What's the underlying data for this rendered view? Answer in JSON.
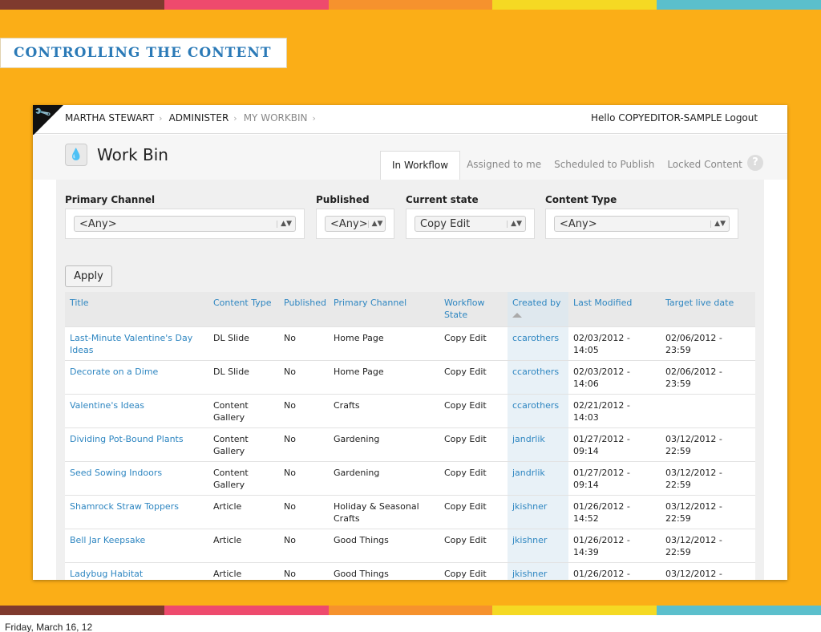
{
  "slide": {
    "title": "CONTROLLING THE CONTENT",
    "date": "Friday, March 16, 12",
    "stripe_colors": [
      "#7f3a2e",
      "#ee4a6d",
      "#f6922d",
      "#f5d923",
      "#5bbfcc"
    ],
    "background_color": "#fbae17"
  },
  "topbar": {
    "breadcrumbs": [
      "MARTHA STEWART",
      "ADMINISTER",
      "MY WORKBIN"
    ],
    "greeting": "Hello COPYEDITOR-SAMPLE",
    "logout": "Logout"
  },
  "page": {
    "title": "Work Bin",
    "tabs": [
      "In Workflow",
      "Assigned to me",
      "Scheduled to Publish",
      "Locked Content"
    ],
    "active_tab": "In Workflow",
    "help": "?"
  },
  "filters": {
    "primary_channel": {
      "label": "Primary Channel",
      "value": "<Any>"
    },
    "published": {
      "label": "Published",
      "value": "<Any>"
    },
    "current_state": {
      "label": "Current state",
      "value": "Copy Edit"
    },
    "content_type": {
      "label": "Content Type",
      "value": "<Any>"
    },
    "apply": "Apply"
  },
  "table": {
    "columns": [
      "Title",
      "Content Type",
      "Published",
      "Primary Channel",
      "Workflow State",
      "Created by",
      "Last Modified",
      "Target live date"
    ],
    "sorted_column": "Created by",
    "rows": [
      {
        "title": "Last-Minute Valentine's Day Ideas",
        "type": "DL Slide",
        "published": "No",
        "channel": "Home Page",
        "state": "Copy Edit",
        "created_by": "ccarothers",
        "modified": "02/03/2012 - 14:05",
        "target": "02/06/2012 - 23:59"
      },
      {
        "title": "Decorate on a Dime",
        "type": "DL Slide",
        "published": "No",
        "channel": "Home Page",
        "state": "Copy Edit",
        "created_by": "ccarothers",
        "modified": "02/03/2012 - 14:06",
        "target": "02/06/2012 - 23:59"
      },
      {
        "title": "Valentine's Ideas",
        "type": "Content Gallery",
        "published": "No",
        "channel": "Crafts",
        "state": "Copy Edit",
        "created_by": "ccarothers",
        "modified": "02/21/2012 - 14:03",
        "target": ""
      },
      {
        "title": "Dividing Pot-Bound Plants",
        "type": "Content Gallery",
        "published": "No",
        "channel": "Gardening",
        "state": "Copy Edit",
        "created_by": "jandrlik",
        "modified": "01/27/2012 - 09:14",
        "target": "03/12/2012 - 22:59"
      },
      {
        "title": "Seed Sowing Indoors",
        "type": "Content Gallery",
        "published": "No",
        "channel": "Gardening",
        "state": "Copy Edit",
        "created_by": "jandrlik",
        "modified": "01/27/2012 - 09:14",
        "target": "03/12/2012 - 22:59"
      },
      {
        "title": "Shamrock Straw Toppers",
        "type": "Article",
        "published": "No",
        "channel": "Holiday & Seasonal Crafts",
        "state": "Copy Edit",
        "created_by": "jkishner",
        "modified": "01/26/2012 - 14:52",
        "target": "03/12/2012 - 22:59"
      },
      {
        "title": "Bell Jar Keepsake",
        "type": "Article",
        "published": "No",
        "channel": "Good Things",
        "state": "Copy Edit",
        "created_by": "jkishner",
        "modified": "01/26/2012 - 14:39",
        "target": "03/12/2012 - 22:59"
      },
      {
        "title": "Ladybug Habitat",
        "type": "Article",
        "published": "No",
        "channel": "Good Things",
        "state": "Copy Edit",
        "created_by": "jkishner",
        "modified": "01/26/2012 -",
        "target": "03/12/2012 -"
      }
    ]
  }
}
